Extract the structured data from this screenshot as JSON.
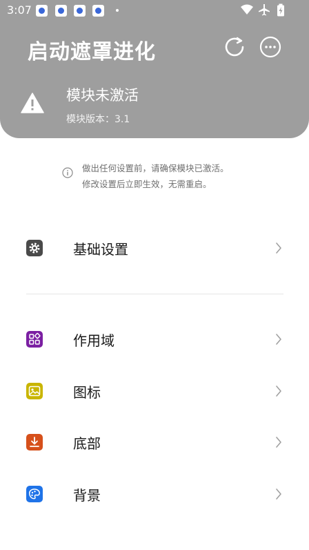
{
  "status_bar": {
    "time": "3:07",
    "icons": [
      "baidu-paw-icon",
      "baidu-paw-icon",
      "baidu-paw-icon",
      "baidu-paw-icon",
      "dot-icon",
      "wifi-icon",
      "airplane-icon",
      "battery-charging-icon"
    ]
  },
  "header": {
    "title": "启动遮罩进化",
    "refresh_icon": "refresh-icon",
    "more_icon": "more-icon"
  },
  "module": {
    "status": "模块未激活",
    "version": "模块版本：3.1",
    "icon": "warning-icon"
  },
  "notice": {
    "line1": "做出任何设置前，请确保模块已激活。",
    "line2": "修改设置后立即生效，无需重启。"
  },
  "menu": [
    {
      "label": "基础设置",
      "icon": "gear-icon",
      "color": "#4a4a4a"
    },
    {
      "label": "作用域",
      "icon": "apps-icon",
      "color": "#7b1fa2"
    },
    {
      "label": "图标",
      "icon": "image-icon",
      "color": "#c9b500"
    },
    {
      "label": "底部",
      "icon": "download-icon",
      "color": "#d6501b"
    },
    {
      "label": "背景",
      "icon": "palette-icon",
      "color": "#1f73e8"
    }
  ],
  "colors": {
    "header_bg": "#9e9e9e",
    "text_primary": "#1a1a1a",
    "text_secondary": "#6f6f6f"
  }
}
